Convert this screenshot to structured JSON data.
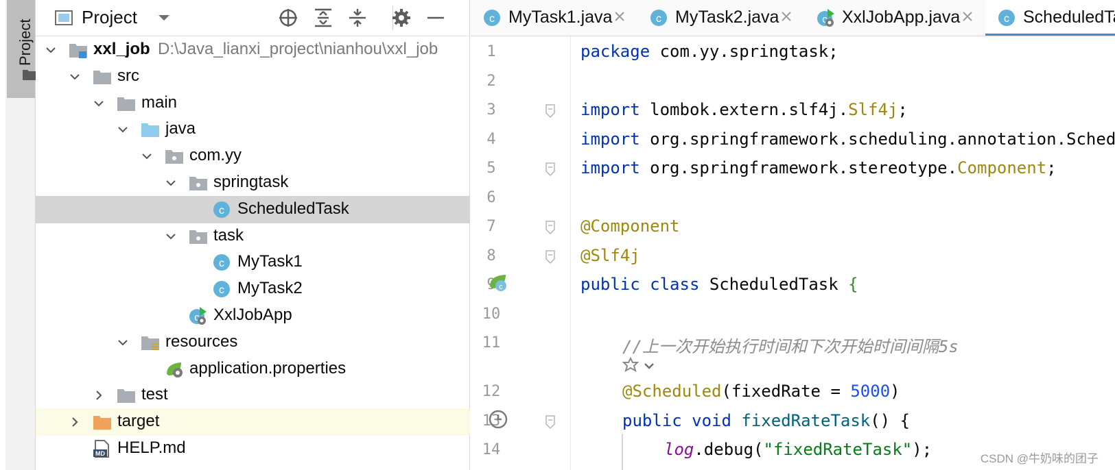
{
  "toolstrip": {
    "project_tab_label": "Project"
  },
  "project_panel": {
    "title": "Project",
    "tree": [
      {
        "name": "xxl_job",
        "path": "D:\\Java_lianxi_project\\nianhou\\xxl_job",
        "icon": "module-folder-icon",
        "expanded": true,
        "level": 0
      },
      {
        "name": "src",
        "icon": "folder-icon",
        "expanded": true,
        "level": 1
      },
      {
        "name": "main",
        "icon": "folder-icon",
        "expanded": true,
        "level": 2
      },
      {
        "name": "java",
        "icon": "source-root-folder-icon",
        "expanded": true,
        "level": 3
      },
      {
        "name": "com.yy",
        "icon": "package-icon",
        "expanded": true,
        "level": 4
      },
      {
        "name": "springtask",
        "icon": "package-icon",
        "expanded": true,
        "level": 5
      },
      {
        "name": "ScheduledTask",
        "icon": "java-class-icon",
        "level": 6,
        "selected": true
      },
      {
        "name": "task",
        "icon": "package-icon",
        "expanded": true,
        "level": 5
      },
      {
        "name": "MyTask1",
        "icon": "java-class-icon",
        "level": 6
      },
      {
        "name": "MyTask2",
        "icon": "java-class-icon",
        "level": 6
      },
      {
        "name": "XxlJobApp",
        "icon": "spring-boot-app-icon",
        "level": 5
      },
      {
        "name": "resources",
        "icon": "resources-folder-icon",
        "expanded": true,
        "level": 3
      },
      {
        "name": "application.properties",
        "icon": "spring-properties-icon",
        "level": 4
      },
      {
        "name": "test",
        "icon": "folder-icon",
        "expanded": false,
        "level": 2
      },
      {
        "name": "target",
        "icon": "excluded-folder-icon",
        "expanded": false,
        "level": 1
      },
      {
        "name": "HELP.md",
        "icon": "markdown-file-icon",
        "level": 1
      }
    ]
  },
  "editor": {
    "tabs": [
      {
        "label": "MyTask1.java",
        "icon": "java-class-icon"
      },
      {
        "label": "MyTask2.java",
        "icon": "java-class-icon"
      },
      {
        "label": "XxlJobApp.java",
        "icon": "spring-boot-app-icon"
      },
      {
        "label": "ScheduledTask.java",
        "icon": "java-class-icon",
        "active": true
      }
    ],
    "lines": [
      {
        "n": "1",
        "tokens": [
          [
            "kw",
            "package"
          ],
          [
            "",
            "com.yy.springtask;"
          ]
        ]
      },
      {
        "n": "2",
        "tokens": []
      },
      {
        "n": "3",
        "tokens": [
          [
            "kw",
            "import"
          ],
          [
            "",
            "lombok.extern.slf4j."
          ],
          [
            "cls-ref",
            "Slf4j"
          ],
          [
            "",
            ";"
          ]
        ]
      },
      {
        "n": "4",
        "tokens": [
          [
            "kw",
            "import"
          ],
          [
            "",
            "org.springframework.scheduling.annotation.Scheduled;"
          ]
        ]
      },
      {
        "n": "5",
        "tokens": [
          [
            "kw",
            "import"
          ],
          [
            "",
            "org.springframework.stereotype."
          ],
          [
            "cls-ref",
            "Component"
          ],
          [
            "",
            ";"
          ]
        ]
      },
      {
        "n": "6",
        "tokens": []
      },
      {
        "n": "7",
        "tokens": [
          [
            "ann",
            "@Component"
          ]
        ]
      },
      {
        "n": "8",
        "tokens": [
          [
            "ann",
            "@Slf4j"
          ]
        ]
      },
      {
        "n": "9",
        "tokens": [
          [
            "kw",
            "public"
          ],
          [
            "kw",
            "class"
          ],
          [
            "",
            "ScheduledTask"
          ],
          [
            "brace-g",
            "{"
          ]
        ]
      },
      {
        "n": "10",
        "tokens": []
      },
      {
        "n": "11",
        "indent": 1,
        "tokens": [
          [
            "cmt",
            "//上一次开始执行时间和下次开始时间间隔5s"
          ]
        ]
      },
      {
        "n": "12",
        "indent": 1,
        "tokens": [
          [
            "ann",
            "@Scheduled"
          ],
          [
            "",
            "(fixedRate = "
          ],
          [
            "num",
            "5000"
          ],
          [
            "",
            ")"
          ]
        ]
      },
      {
        "n": "13",
        "indent": 1,
        "tokens": [
          [
            "kw",
            "public"
          ],
          [
            "kw",
            "void"
          ],
          [
            "meth",
            "fixedRateTask"
          ],
          [
            "",
            "() {"
          ]
        ]
      },
      {
        "n": "14",
        "indent": 2,
        "tokens": [
          [
            "logv",
            "log"
          ],
          [
            "",
            ".debug("
          ],
          [
            "str",
            "\"fixedRateTask\""
          ],
          [
            "",
            ");"
          ]
        ]
      }
    ]
  },
  "watermark": "CSDN @牛奶味的团子"
}
